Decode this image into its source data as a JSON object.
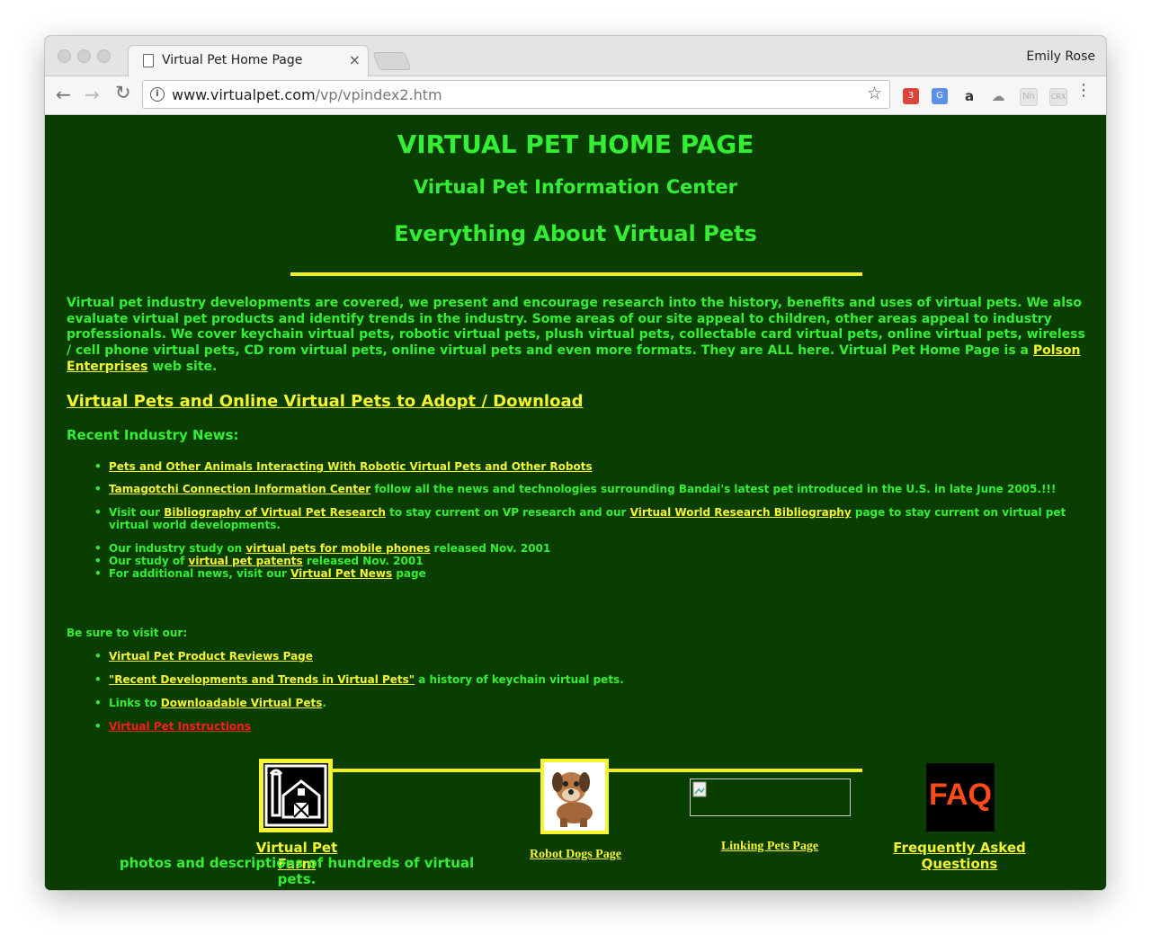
{
  "browser": {
    "tab_title": "Virtual Pet Home Page",
    "tab_close": "×",
    "profile_name": "Emily Rose",
    "url_host": "www.virtualpet.com",
    "url_path": "/vp/vpindex2.htm",
    "back": "←",
    "forward": "→",
    "reload": "↻",
    "info": "i",
    "star": "☆",
    "extensions": [
      {
        "name": "counter-extension",
        "label": "3",
        "color": "#d9453a"
      },
      {
        "name": "translate-extension",
        "label": "G",
        "color": "#5b8fe8"
      },
      {
        "name": "amazon-extension",
        "label": "a",
        "color": "#333333"
      },
      {
        "name": "cloud-extension",
        "label": "☁",
        "color": "#888888"
      },
      {
        "name": "nh-extension",
        "label": "Nh",
        "color": "#b8b8b8"
      },
      {
        "name": "crx-extension",
        "label": "CRX",
        "color": "#c4c4c4"
      }
    ],
    "menu": "⋮"
  },
  "page": {
    "title": "VIRTUAL PET HOME PAGE",
    "subtitle": "Virtual Pet Information Center",
    "tagline": "Everything About Virtual Pets",
    "intro_text": "Virtual pet industry developments are covered, we present and encourage research into the history, benefits and uses of virtual pets. We also evaluate virtual pet products and identify trends in the industry. Some areas of our site appeal to children, other areas appeal to industry professionals. We cover keychain virtual pets, robotic virtual pets, plush virtual pets, collectable card virtual pets, online virtual pets, wireless / cell phone virtual pets, CD rom virtual pets, online virtual pets and even more formats. They are ALL here. Virtual Pet Home Page is a",
    "intro_link": "Polson Enterprises",
    "intro_end": " web site.",
    "adopt_link": "Virtual Pets and Online Virtual Pets to Adopt / Download",
    "news_heading": "Recent Industry News:",
    "news": {
      "item1_link": "Pets and Other Animals Interacting With Robotic Virtual Pets and Other Robots",
      "item2_link": "Tamagotchi Connection Information Center",
      "item2_text": " follow all the news and technologies surrounding Bandai's latest pet introduced in the U.S. in late June 2005.!!!",
      "item3_pre": "Visit our ",
      "item3_link1": "Bibliography of Virtual Pet Research",
      "item3_mid": " to stay current on VP research and our ",
      "item3_link2": "Virtual World Research Bibliography",
      "item3_end": " page to stay current on virtual pet virtual world developments.",
      "item4_pre": "Our industry study on ",
      "item4_link": "virtual pets for mobile phones",
      "item4_end": " released Nov. 2001",
      "item5_pre": "Our study of ",
      "item5_link": "virtual pet patents",
      "item5_end": " released Nov. 2001",
      "item6_pre": "For additional news, visit our ",
      "item6_link": "Virtual Pet News",
      "item6_end": " page"
    },
    "visit_heading": "Be sure to visit our:",
    "visit": {
      "item1_link": "Virtual Pet Product Reviews Page",
      "item2_link": "\"Recent Developments and Trends in Virtual Pets\"",
      "item2_text": " a history of keychain virtual pets.",
      "item3_pre": "Links to ",
      "item3_link": "Downloadable Virtual Pets",
      "item3_end": ".",
      "item4_link": "Virtual Pet Instructions"
    },
    "footer": {
      "farm_link": "Virtual Pet Farm",
      "farm_desc": "photos and descriptions of hundreds of virtual pets.",
      "robot_link": "Robot Dogs Page",
      "linking_link": "Linking Pets Page",
      "faq_badge": "FAQ",
      "faq_link_line1": "Frequently Asked",
      "faq_link_line2": "Questions"
    },
    "colors": {
      "background": "#0a3d00",
      "text": "#33ee33",
      "link": "#f5f530",
      "red_link": "#ff1a1a",
      "rule": "#f0f020"
    }
  }
}
